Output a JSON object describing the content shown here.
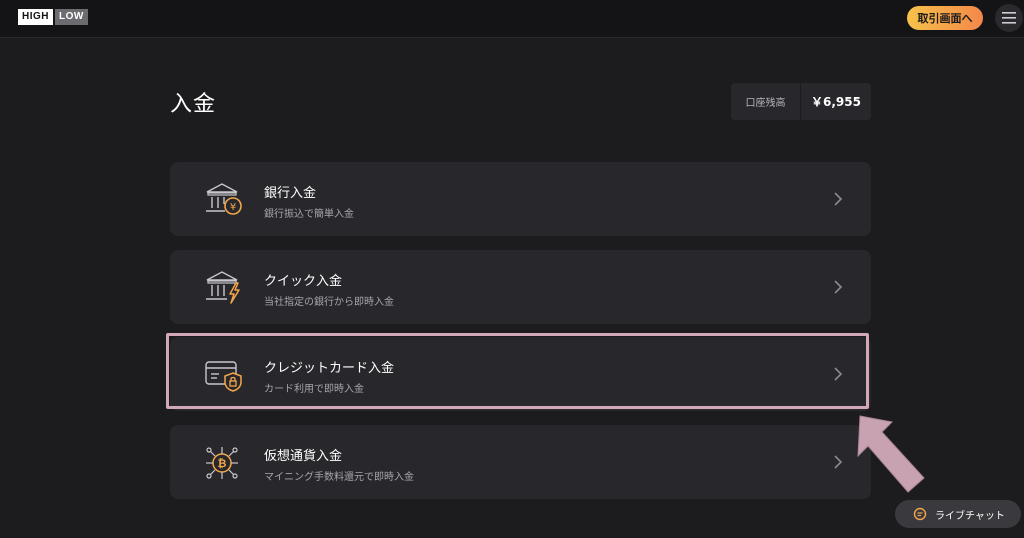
{
  "header": {
    "logo_high": "HIGH",
    "logo_low": "LOW",
    "trade_button": "取引画面へ"
  },
  "page": {
    "title": "入金",
    "balance_label": "口座残高",
    "balance_value": "￥6,955"
  },
  "methods": [
    {
      "title": "銀行入金",
      "subtitle": "銀行振込で簡単入金",
      "icon": "bank-yen-icon"
    },
    {
      "title": "クイック入金",
      "subtitle": "当社指定の銀行から即時入金",
      "icon": "bank-lightning-icon"
    },
    {
      "title": "クレジットカード入金",
      "subtitle": "カード利用で即時入金",
      "icon": "credit-card-lock-icon"
    },
    {
      "title": "仮想通貨入金",
      "subtitle": "マイニング手数料還元で即時入金",
      "icon": "bitcoin-network-icon"
    }
  ],
  "chat": {
    "label": "ライブチャット",
    "icon": "chat-bubble-icon"
  },
  "colors": {
    "accent": "#f3a64a",
    "highlight": "#d2a8b8",
    "card": "#28282c",
    "background": "#1c1c1e"
  }
}
